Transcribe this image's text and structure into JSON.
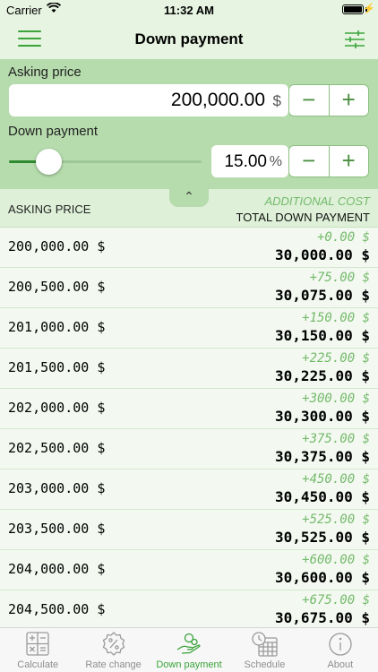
{
  "status_bar": {
    "carrier": "Carrier",
    "time": "11:32 AM"
  },
  "nav": {
    "title": "Down payment",
    "menu_icon": "menu-icon",
    "filter_icon": "sliders-icon"
  },
  "inputs": {
    "asking_price_label": "Asking price",
    "asking_price_value": "200,000.00",
    "currency_unit": "$",
    "down_payment_label": "Down payment",
    "down_payment_value": "15.00",
    "percent_unit": "%",
    "slider_level": 0.15,
    "minus": "−",
    "plus": "+"
  },
  "table": {
    "collapse_glyph": "⌃",
    "col_left": "ASKING PRICE",
    "col_additional": "ADDITIONAL COST",
    "col_total": "TOTAL DOWN PAYMENT",
    "rows": [
      {
        "price": "200,000.00 $",
        "additional": "+0.00 $",
        "total": "30,000.00 $"
      },
      {
        "price": "200,500.00 $",
        "additional": "+75.00 $",
        "total": "30,075.00 $"
      },
      {
        "price": "201,000.00 $",
        "additional": "+150.00 $",
        "total": "30,150.00 $"
      },
      {
        "price": "201,500.00 $",
        "additional": "+225.00 $",
        "total": "30,225.00 $"
      },
      {
        "price": "202,000.00 $",
        "additional": "+300.00 $",
        "total": "30,300.00 $"
      },
      {
        "price": "202,500.00 $",
        "additional": "+375.00 $",
        "total": "30,375.00 $"
      },
      {
        "price": "203,000.00 $",
        "additional": "+450.00 $",
        "total": "30,450.00 $"
      },
      {
        "price": "203,500.00 $",
        "additional": "+525.00 $",
        "total": "30,525.00 $"
      },
      {
        "price": "204,000.00 $",
        "additional": "+600.00 $",
        "total": "30,600.00 $"
      },
      {
        "price": "204,500.00 $",
        "additional": "+675.00 $",
        "total": "30,675.00 $"
      }
    ]
  },
  "tabs": [
    {
      "label": "Calculate",
      "icon": "calculator-icon",
      "active": false
    },
    {
      "label": "Rate change",
      "icon": "percent-badge-icon",
      "active": false
    },
    {
      "label": "Down payment",
      "icon": "hand-coins-icon",
      "active": true
    },
    {
      "label": "Schedule",
      "icon": "calendar-clock-icon",
      "active": false
    },
    {
      "label": "About",
      "icon": "info-icon",
      "active": false
    }
  ],
  "colors": {
    "accent": "#3aa33a",
    "panel": "#b6dcad",
    "header": "#e6f4e1",
    "additional_text": "#74b96b"
  }
}
